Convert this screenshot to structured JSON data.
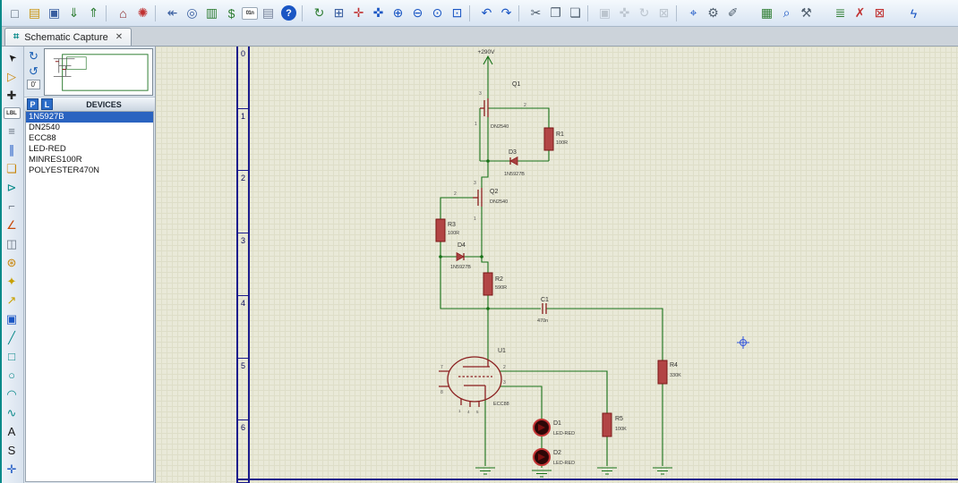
{
  "colors": {
    "wire_green": "#177117",
    "component_red": "#8b1f1f",
    "resistor_fill": "#b24545",
    "selection_blue": "#2a63c0",
    "sheet_border_blue": "#1a1a8c",
    "canvas_beige": "#e9e9d8"
  },
  "tab": {
    "icon": "⌗",
    "label": "Schematic Capture",
    "close": "✕"
  },
  "toolbar": {
    "icons": [
      {
        "name": "new-file-icon",
        "glyph": "□",
        "color": "#51606f"
      },
      {
        "name": "open-folder-icon",
        "glyph": "▤",
        "color": "#c8920a"
      },
      {
        "name": "save-icon",
        "glyph": "▣",
        "color": "#3a5fa0"
      },
      {
        "name": "import-section-icon",
        "glyph": "⇓",
        "color": "#2e7d32"
      },
      {
        "name": "export-section-icon",
        "glyph": "⇑",
        "color": "#2e7d32"
      },
      {
        "name": "toolbar-separator",
        "glyph": "",
        "cls": "sep",
        "interactable": false
      },
      {
        "name": "board-view-icon",
        "glyph": "⌂",
        "color": "#8a2525"
      },
      {
        "name": "mark-output-icon",
        "glyph": "✺",
        "color": "#c03030"
      },
      {
        "name": "toolbar-separator",
        "glyph": "",
        "cls": "sep",
        "interactable": false
      },
      {
        "name": "undo-list-icon",
        "glyph": "↞",
        "color": "#3a5fa0"
      },
      {
        "name": "find-part-icon",
        "glyph": "◎",
        "color": "#3a5fa0"
      },
      {
        "name": "bom-icon",
        "glyph": "▥",
        "color": "#2e7d32"
      },
      {
        "name": "cost-report-icon",
        "glyph": "$",
        "color": "#2e7d32"
      },
      {
        "name": "units-icon",
        "glyph": "01n",
        "color": "#333",
        "cls": "small"
      },
      {
        "name": "design-notes-icon",
        "glyph": "▤",
        "color": "#76829a"
      },
      {
        "name": "help-icon",
        "glyph": "?",
        "color": "#ffffff",
        "bg": "#1a56c4",
        "cls": "help"
      },
      {
        "name": "toolbar-separator",
        "glyph": "",
        "cls": "sep",
        "interactable": false
      },
      {
        "name": "redraw-icon",
        "glyph": "↻",
        "color": "#2e7d32"
      },
      {
        "name": "grid-toggle-icon",
        "glyph": "⊞",
        "color": "#3a5fa0"
      },
      {
        "name": "origin-icon",
        "glyph": "✛",
        "color": "#c03030"
      },
      {
        "name": "pan-icon",
        "glyph": "✜",
        "color": "#1a56c4"
      },
      {
        "name": "zoom-in-icon",
        "glyph": "⊕",
        "color": "#1a56c4"
      },
      {
        "name": "zoom-out-icon",
        "glyph": "⊖",
        "color": "#1a56c4"
      },
      {
        "name": "zoom-all-icon",
        "glyph": "⊙",
        "color": "#1a56c4"
      },
      {
        "name": "zoom-area-icon",
        "glyph": "⊡",
        "color": "#1a56c4"
      },
      {
        "name": "toolbar-separator",
        "glyph": "",
        "cls": "sep",
        "interactable": false
      },
      {
        "name": "undo-icon",
        "glyph": "↶",
        "color": "#1a56c4"
      },
      {
        "name": "redo-icon",
        "glyph": "↷",
        "color": "#1a56c4"
      },
      {
        "name": "toolbar-separator",
        "glyph": "",
        "cls": "sep",
        "interactable": false
      },
      {
        "name": "cut-icon",
        "glyph": "✂",
        "color": "#51606f"
      },
      {
        "name": "copy-icon",
        "glyph": "❐",
        "color": "#51606f"
      },
      {
        "name": "paste-icon",
        "glyph": "❏",
        "color": "#51606f"
      },
      {
        "name": "toolbar-separator",
        "glyph": "",
        "cls": "sep",
        "interactable": false
      },
      {
        "name": "block-copy-icon",
        "glyph": "▣",
        "color": "#9aa4ae",
        "cls": "dim"
      },
      {
        "name": "block-move-icon",
        "glyph": "✜",
        "color": "#9aa4ae",
        "cls": "dim"
      },
      {
        "name": "block-rotate-icon",
        "glyph": "↻",
        "color": "#9aa4ae",
        "cls": "dim"
      },
      {
        "name": "block-delete-icon",
        "glyph": "⊠",
        "color": "#9aa4ae",
        "cls": "dim"
      },
      {
        "name": "toolbar-separator",
        "glyph": "",
        "cls": "sep",
        "interactable": false
      },
      {
        "name": "pick-parts-icon",
        "glyph": "⌖",
        "color": "#1a56c4"
      },
      {
        "name": "configure-icon",
        "glyph": "⚙",
        "color": "#51606f"
      },
      {
        "name": "property-assignment-icon",
        "glyph": "✐",
        "color": "#51606f"
      },
      {
        "name": "netlist-icon",
        "glyph": "▦",
        "color": "#2e7d32",
        "cls": "gap"
      },
      {
        "name": "search-icon",
        "glyph": "⌕",
        "color": "#1a56c4"
      },
      {
        "name": "design-tools-icon",
        "glyph": "⚒",
        "color": "#51606f"
      },
      {
        "name": "sheet-list-icon",
        "glyph": "≣",
        "color": "#2e7d32",
        "cls": "gap"
      },
      {
        "name": "remove-sheet-icon",
        "glyph": "✗",
        "color": "#c03030"
      },
      {
        "name": "exclude-icon",
        "glyph": "⊠",
        "color": "#c03030"
      },
      {
        "name": "electrical-rules-icon",
        "glyph": "ϟ",
        "color": "#1a56c4",
        "cls": "gap"
      }
    ]
  },
  "modebar": {
    "tools": [
      {
        "name": "selection-mode-icon",
        "glyph": "➤",
        "color": "#1a1a1a",
        "cls": "cursor"
      },
      {
        "name": "component-mode-icon",
        "glyph": "▷",
        "color": "#c8860a"
      },
      {
        "name": "junction-dot-mode-icon",
        "glyph": "✚",
        "color": "#2a2a2a"
      },
      {
        "name": "wire-label-mode-icon",
        "glyph": "LBL",
        "color": "#2a2a2a",
        "cls": "small"
      },
      {
        "name": "text-script-mode-icon",
        "glyph": "≡",
        "color": "#6a7684"
      },
      {
        "name": "bus-mode-icon",
        "glyph": "∥",
        "color": "#1a56c4"
      },
      {
        "name": "subcircuit-mode-icon",
        "glyph": "❏",
        "color": "#c8860a"
      },
      {
        "name": "terminal-mode-icon",
        "glyph": "⊳",
        "color": "#0a8a8a"
      },
      {
        "name": "device-pin-mode-icon",
        "glyph": "⌐",
        "color": "#6a7684"
      },
      {
        "name": "graph-mode-icon",
        "glyph": "∠",
        "color": "#c84a0a"
      },
      {
        "name": "tape-recorder-mode-icon",
        "glyph": "◫",
        "color": "#6a7684"
      },
      {
        "name": "generator-mode-icon",
        "glyph": "⊛",
        "color": "#c8860a"
      },
      {
        "name": "voltage-probe-mode-icon",
        "glyph": "✦",
        "color": "#c8a000"
      },
      {
        "name": "current-probe-mode-icon",
        "glyph": "↗",
        "color": "#c8a000"
      },
      {
        "name": "virtual-instrument-mode-icon",
        "glyph": "▣",
        "color": "#1a56c4"
      },
      {
        "name": "2d-line-mode-icon",
        "glyph": "╱",
        "color": "#0a8a8a"
      },
      {
        "name": "2d-box-mode-icon",
        "glyph": "□",
        "color": "#0a8a8a"
      },
      {
        "name": "2d-circle-mode-icon",
        "glyph": "○",
        "color": "#0a8a8a"
      },
      {
        "name": "2d-arc-mode-icon",
        "glyph": "◠",
        "color": "#0a8a8a"
      },
      {
        "name": "2d-path-mode-icon",
        "glyph": "∿",
        "color": "#0a8a8a"
      },
      {
        "name": "2d-text-mode-icon",
        "glyph": "A",
        "color": "#1a1a1a"
      },
      {
        "name": "2d-symbol-mode-icon",
        "glyph": "S",
        "color": "#1a1a1a"
      },
      {
        "name": "2d-marker-mode-icon",
        "glyph": "✛",
        "color": "#1a56c4"
      }
    ]
  },
  "rotation": {
    "cw": "↻",
    "ccw": "↺",
    "angle": "0'"
  },
  "devices_panel": {
    "p": "P",
    "l": "L",
    "header": "DEVICES",
    "items": [
      {
        "label": "1N5927B",
        "selected": true
      },
      {
        "label": "DN2540"
      },
      {
        "label": "ECC88"
      },
      {
        "label": "LED-RED"
      },
      {
        "label": "MINRES100R"
      },
      {
        "label": "POLYESTER470N"
      }
    ]
  },
  "ruler": {
    "marks": [
      "0",
      "1",
      "2",
      "3",
      "4",
      "5",
      "6"
    ]
  },
  "schematic": {
    "power_label": "+290V",
    "components": [
      {
        "ref": "Q1",
        "value": "DN2540"
      },
      {
        "ref": "R1",
        "value": "100R"
      },
      {
        "ref": "D3",
        "value": "1N5927B"
      },
      {
        "ref": "Q2",
        "value": "DN2540"
      },
      {
        "ref": "R3",
        "value": "100R"
      },
      {
        "ref": "D4",
        "value": "1N5927B"
      },
      {
        "ref": "R2",
        "value": "590R"
      },
      {
        "ref": "C1",
        "value": "470n"
      },
      {
        "ref": "U1",
        "value": "ECC88"
      },
      {
        "ref": "R4",
        "value": "330K"
      },
      {
        "ref": "R5",
        "value": "100K"
      },
      {
        "ref": "D1",
        "value": "LED-RED"
      },
      {
        "ref": "D2",
        "value": "LED-RED"
      }
    ],
    "pins": {
      "q1_3": "3",
      "q1_2": "2",
      "q1_1": "1",
      "q2_3": "3",
      "q2_2": "2",
      "q2_1": "1",
      "u1_7": "7",
      "u1_8": "8",
      "u1_2": "2",
      "u1_3": "3",
      "u1_1": "1",
      "u1_4": "4",
      "u1_5": "5"
    }
  }
}
